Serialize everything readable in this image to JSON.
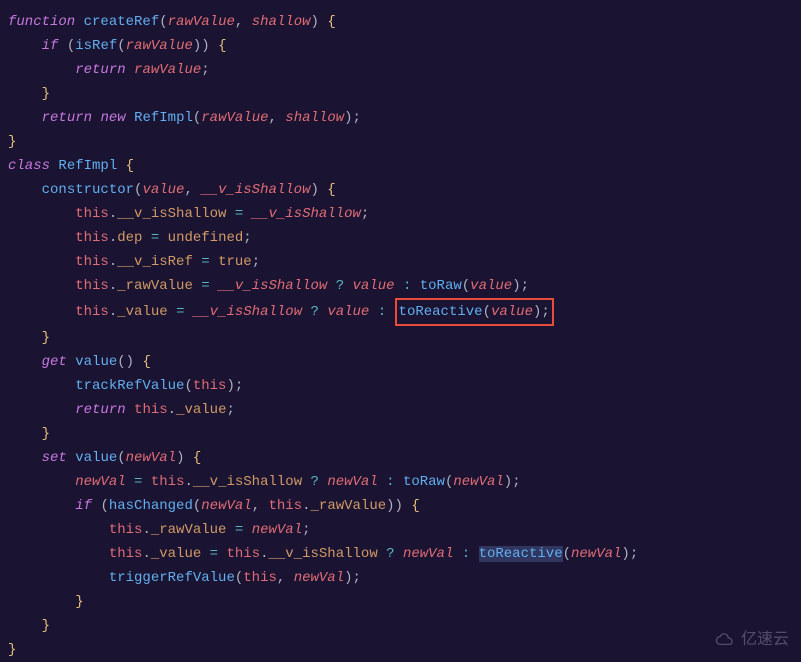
{
  "code": {
    "l1": {
      "kw_fn": "function",
      "fnName": "createRef",
      "p1": "rawValue",
      "p2": "shallow"
    },
    "l2": {
      "kw_if": "if",
      "fn": "isRef",
      "arg": "rawValue"
    },
    "l3": {
      "kw_return": "return",
      "val": "rawValue"
    },
    "l5": {
      "kw_return": "return",
      "kw_new": "new",
      "cls": "RefImpl",
      "a1": "rawValue",
      "a2": "shallow"
    },
    "l7": {
      "kw_class": "class",
      "cls": "RefImpl"
    },
    "l8": {
      "ctor": "constructor",
      "p1": "value",
      "p2": "__v_isShallow"
    },
    "l9": {
      "this": "this",
      "prop": "__v_isShallow",
      "val": "__v_isShallow"
    },
    "l10": {
      "this": "this",
      "prop": "dep",
      "val": "undefined"
    },
    "l11": {
      "this": "this",
      "prop": "__v_isRef",
      "val": "true"
    },
    "l12": {
      "this": "this",
      "prop": "_rawValue",
      "cond": "__v_isShallow",
      "t": "value",
      "fn": "toRaw",
      "arg": "value"
    },
    "l13": {
      "this": "this",
      "prop": "_value",
      "cond": "__v_isShallow",
      "t": "value",
      "fn": "toReactive",
      "arg": "value"
    },
    "l15": {
      "kw_get": "get",
      "fn": "value"
    },
    "l16": {
      "fn": "trackRefValue",
      "this": "this"
    },
    "l17": {
      "kw_return": "return",
      "this": "this",
      "prop": "_value"
    },
    "l19": {
      "kw_set": "set",
      "fn": "value",
      "p": "newVal"
    },
    "l20": {
      "v": "newVal",
      "this": "this",
      "prop": "__v_isShallow",
      "t": "newVal",
      "fn": "toRaw",
      "arg": "newVal"
    },
    "l21": {
      "kw_if": "if",
      "fn": "hasChanged",
      "a1": "newVal",
      "this": "this",
      "prop": "_rawValue"
    },
    "l22": {
      "this": "this",
      "prop": "_rawValue",
      "val": "newVal"
    },
    "l23": {
      "this": "this",
      "prop": "_value",
      "this2": "this",
      "cond": "__v_isShallow",
      "t": "newVal",
      "fn": "toReactive",
      "arg": "newVal"
    },
    "l24": {
      "fn": "triggerRefValue",
      "this": "this",
      "a2": "newVal"
    }
  },
  "watermark": "亿速云"
}
